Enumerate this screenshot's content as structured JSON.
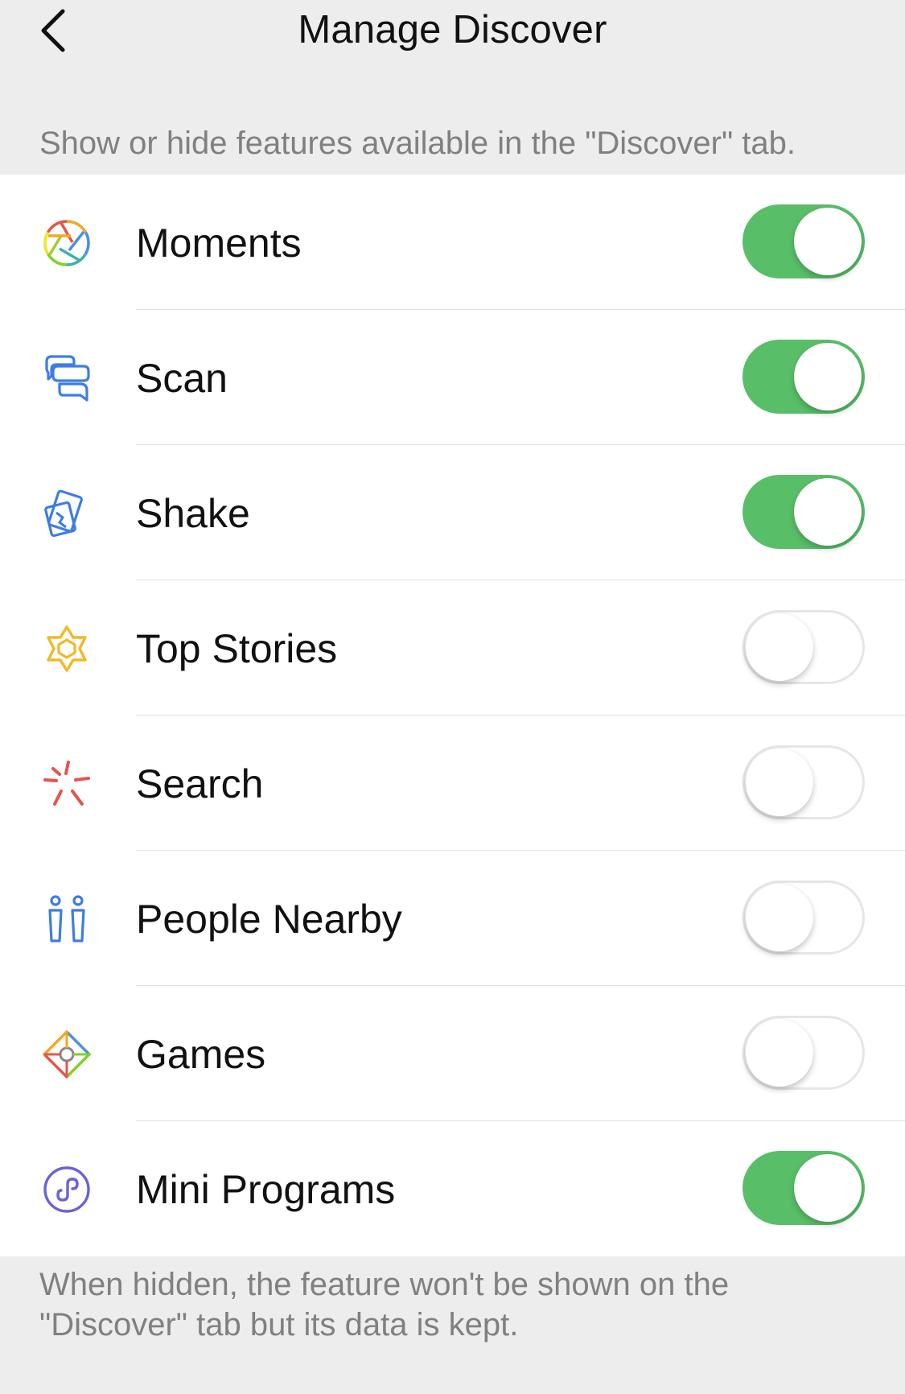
{
  "nav": {
    "title": "Manage Discover",
    "back_icon": "chevron-left-icon"
  },
  "header_note": "Show or hide features available in the \"Discover\" tab.",
  "features": [
    {
      "label": "Moments",
      "icon": "moments-aperture-icon",
      "enabled": true
    },
    {
      "label": "Scan",
      "icon": "scan-icon",
      "enabled": true
    },
    {
      "label": "Shake",
      "icon": "shake-icon",
      "enabled": true
    },
    {
      "label": "Top Stories",
      "icon": "top-stories-star-icon",
      "enabled": false
    },
    {
      "label": "Search",
      "icon": "search-sparkle-icon",
      "enabled": false
    },
    {
      "label": "People Nearby",
      "icon": "people-nearby-icon",
      "enabled": false
    },
    {
      "label": "Games",
      "icon": "games-diamond-icon",
      "enabled": false
    },
    {
      "label": "Mini Programs",
      "icon": "mini-programs-icon",
      "enabled": true
    }
  ],
  "footer_note": "When hidden, the feature won't be shown on the \"Discover\" tab but its data is kept.",
  "colors": {
    "toggle_on": "#58bf68",
    "background": "#ededed",
    "icon_blue": "#3d7de3",
    "icon_yellow": "#f2b826",
    "icon_red": "#e8534a",
    "icon_purple": "#6a62d9"
  }
}
